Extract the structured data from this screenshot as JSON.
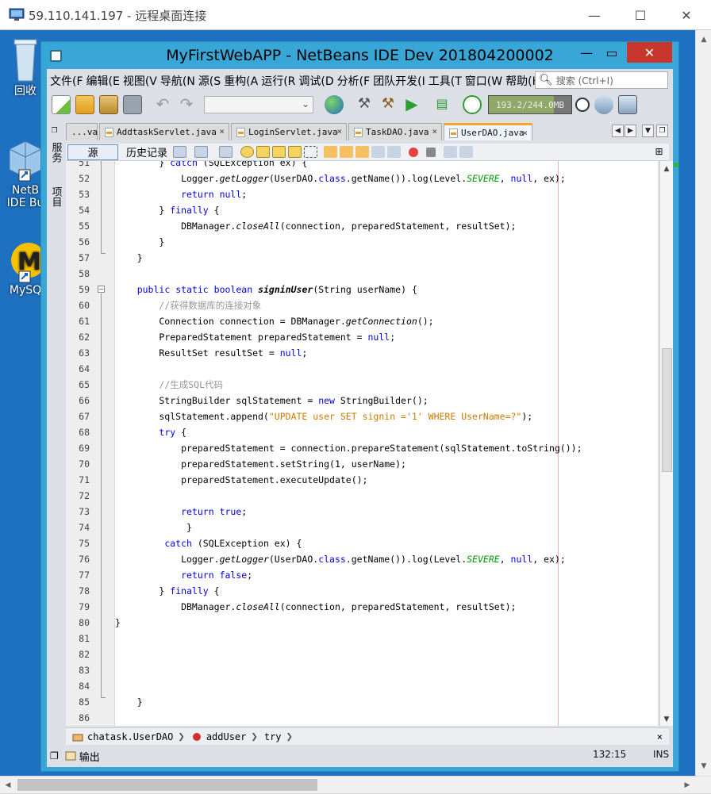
{
  "rdp": {
    "title": "59.110.141.197 - 远程桌面连接"
  },
  "desktop": {
    "icons": [
      {
        "label": "回收"
      },
      {
        "label": "NetB\nIDE Bu"
      },
      {
        "label": "MySQ"
      }
    ]
  },
  "netbeans": {
    "title": "MyFirstWebAPP - NetBeans IDE Dev 201804200002",
    "menu": [
      "文件(F",
      "编辑(E",
      "视图(V",
      "导航(N",
      "源(S",
      "重构(A",
      "运行(R",
      "调试(D",
      "分析(F",
      "团队开发(I",
      "工具(T",
      "窗口(W",
      "帮助(H"
    ],
    "search_placeholder": "搜索 (Ctrl+I)",
    "memory": "193.2/244.0MB",
    "tabs": [
      {
        "label": "...va",
        "active": false
      },
      {
        "label": "AddtaskServlet.java",
        "active": false
      },
      {
        "label": "LoginServlet.java",
        "active": false
      },
      {
        "label": "TaskDAO.java",
        "active": false
      },
      {
        "label": "UserDAO.java",
        "active": true
      }
    ],
    "side": {
      "services": "服务",
      "projects": "项目"
    },
    "editor": {
      "source_btn": "源",
      "history_btn": "历史记录"
    },
    "breadcrumb": [
      "chatask.UserDAO",
      "addUser",
      "try"
    ],
    "status": {
      "output": "输出",
      "position": "132:15",
      "mode": "INS"
    }
  }
}
